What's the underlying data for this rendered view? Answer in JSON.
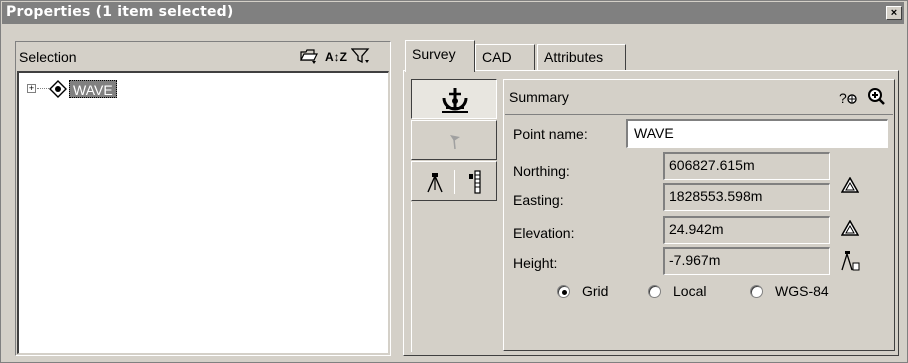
{
  "window": {
    "title": "Properties (1 item selected)",
    "close_glyph": "×"
  },
  "selection": {
    "label": "Selection",
    "toolbar_icons": [
      "select-folder-icon",
      "sort-az-icon",
      "filter-icon"
    ],
    "sort_glyph": "A↕Z",
    "tree": [
      {
        "label": "WAVE",
        "expander": "+",
        "icon": "survey-point-icon",
        "selected": true
      }
    ]
  },
  "tabs": [
    {
      "label": "Survey",
      "active": true
    },
    {
      "label": "CAD",
      "active": false
    },
    {
      "label": "Attributes",
      "active": false
    }
  ],
  "side_buttons": [
    {
      "icon": "sextant-icon",
      "active": true
    },
    {
      "icon": "flag-icon",
      "active": false,
      "disabled": true
    },
    {
      "icon": "instrument-icon",
      "active": false
    },
    {
      "icon": "rod-icon",
      "active": false
    }
  ],
  "summary": {
    "label": "Summary",
    "help_glyph": "?",
    "point_name_label": "Point name:",
    "point_name_value": "WAVE",
    "fields": [
      {
        "label": "Northing:",
        "value": "606827.615m"
      },
      {
        "label": "Easting:",
        "value": "1828553.598m"
      },
      {
        "label": "Elevation:",
        "value": "24.942m"
      },
      {
        "label": "Height:",
        "value": "-7.967m"
      }
    ],
    "coord_system": {
      "options": [
        "Grid",
        "Local",
        "WGS-84"
      ],
      "selected": "Grid"
    }
  }
}
